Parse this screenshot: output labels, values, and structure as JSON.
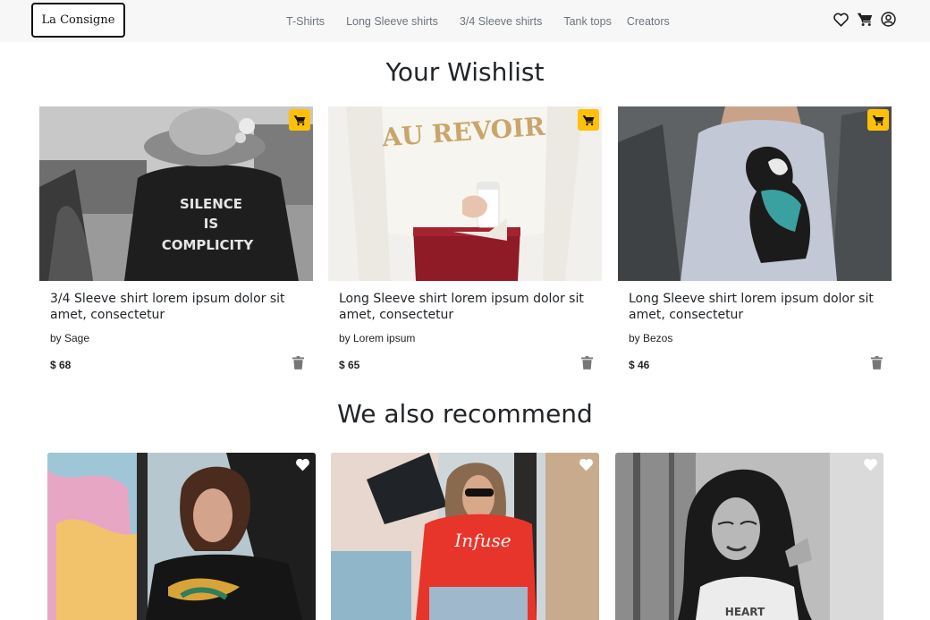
{
  "navbar": {
    "brand": "La Consigne",
    "links": [
      "T-Shirts",
      "Long Sleeve shirts",
      "3/4 Sleeve shirts",
      "Tank tops",
      "Creators"
    ],
    "icons": [
      "heart-icon",
      "cart-icon",
      "user-icon"
    ]
  },
  "wishlist": {
    "title": "Your Wishlist",
    "items": [
      {
        "title": "3/4 Sleeve shirt lorem ipsum dolor sit amet, consectetur",
        "by": "by Sage",
        "price": "$ 68",
        "image": "back of person in black t-shirt reading SILENCE IS COMPLICITY"
      },
      {
        "title": "Long Sleeve shirt lorem ipsum dolor sit amet, consectetur",
        "by": "by Lorem ipsum",
        "price": "$ 65",
        "image": "white AU REVOIR sweatshirt with red trousers"
      },
      {
        "title": "Long Sleeve shirt lorem ipsum dolor sit amet, consectetur",
        "by": "by Bezos",
        "price": "$ 46",
        "image": "back of grey sweatshirt with masked figure print"
      }
    ]
  },
  "recommend": {
    "title": "We also recommend",
    "items": [
      {
        "image": "woman in black dragon t-shirt by graffiti wall"
      },
      {
        "image": "woman in red Infuse t-shirt on street"
      },
      {
        "image": "black and white woman in white t-shirt"
      }
    ]
  },
  "colors": {
    "accent": "#ffc107",
    "navbar_bg": "#f7f7f8",
    "text": "#212529",
    "muted": "#6c757d"
  }
}
